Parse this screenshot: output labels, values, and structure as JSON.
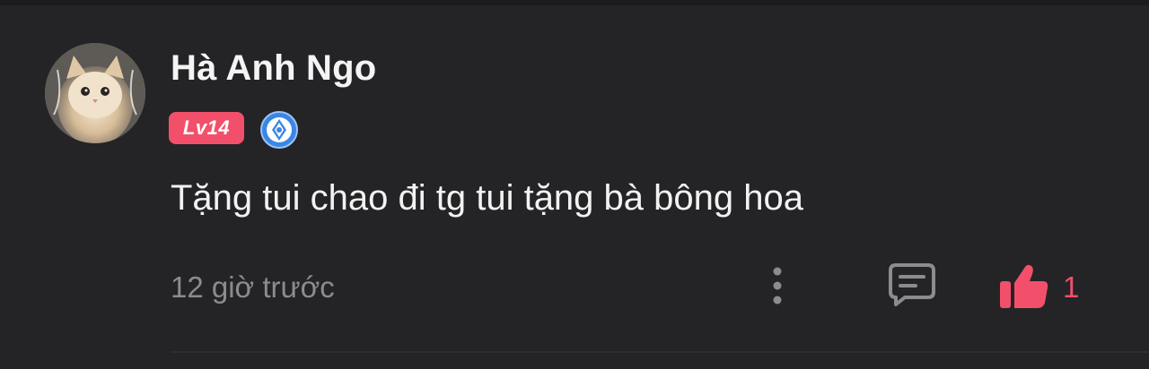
{
  "comment": {
    "username": "Hà Anh Ngo",
    "level_badge": "Lv14",
    "verified_icon": "verified-badge-icon",
    "avatar_icon": "avatar-cat-photo",
    "text": "Tặng tui chao đi tg tui tặng bà bông hoa",
    "timestamp": "12 giờ trước",
    "more_icon": "more-vertical-icon",
    "reply_icon": "reply-comment-icon",
    "like_icon": "thumbs-up-icon",
    "like_count": "1"
  },
  "colors": {
    "background": "#242427",
    "accent": "#f2506a",
    "muted_text": "#8c8c90",
    "primary_text": "#f2f2f2",
    "verified_blue": "#3a86e8"
  }
}
